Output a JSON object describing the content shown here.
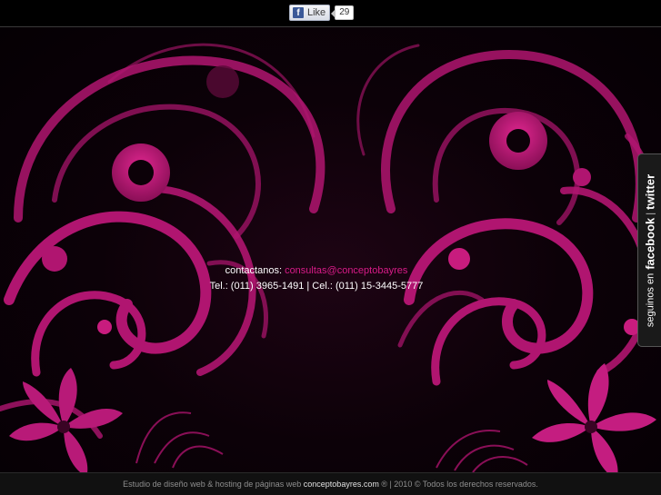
{
  "facebook_like": {
    "icon": "facebook-f-icon",
    "label": "Like",
    "count": "29"
  },
  "contact": {
    "label": "contactanos:",
    "email": "consultas@conceptobayres",
    "phones": "Tel.: (011) 3965-1491 | Cel.: (011) 15-3445-5777"
  },
  "social_tab": {
    "prefix": "seguinos en",
    "facebook": "facebook",
    "separator": "|",
    "twitter": "twitter"
  },
  "footer": {
    "text_before": "Estudio de diseño web & hosting de páginas web ",
    "site": "conceptobayres.com",
    "text_after": " ® | 2010 © Todos los derechos reservados."
  },
  "colors": {
    "accent": "#d81b88",
    "background": "#000000",
    "petal": "#b01570"
  }
}
